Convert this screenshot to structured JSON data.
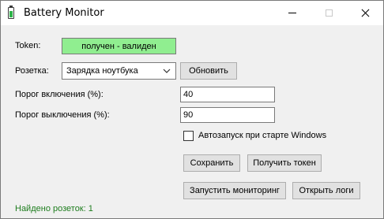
{
  "window": {
    "title": "Battery Monitor"
  },
  "token": {
    "label": "Token:",
    "status": "получен - валиден",
    "status_color": "#90ee90"
  },
  "socket": {
    "label": "Розетка:",
    "selected": "Зарядка ноутбука",
    "refresh_label": "Обновить"
  },
  "thresholds": {
    "on_label": "Порог включения (%):",
    "on_value": "40",
    "off_label": "Порог выключения (%):",
    "off_value": "90"
  },
  "autostart": {
    "label": "Автозапуск при старте Windows",
    "checked": false
  },
  "buttons": {
    "save": "Сохранить",
    "get_token": "Получить токен",
    "start_monitoring": "Запустить мониторинг",
    "open_logs": "Открыть логи"
  },
  "status": {
    "text": "Найдено розеток: 1",
    "color": "#1e7d1e"
  },
  "icons": {
    "app": "battery-icon",
    "minimize": "minimize-icon",
    "maximize": "maximize-icon",
    "close": "close-icon",
    "dropdown": "chevron-down-icon",
    "checkbox": "checkbox-icon"
  }
}
